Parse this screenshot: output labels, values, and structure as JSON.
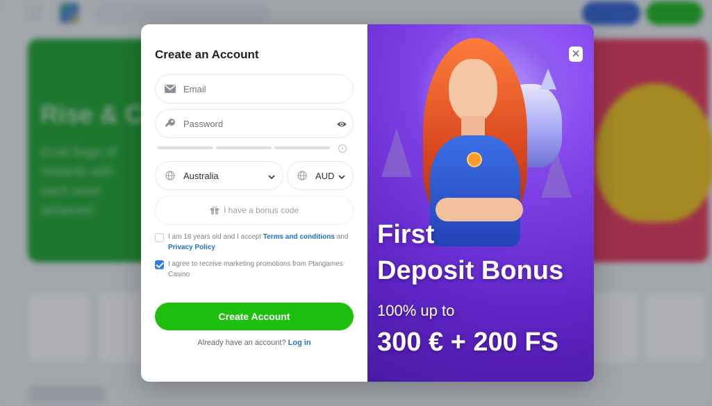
{
  "modal": {
    "title": "Create an Account",
    "email_placeholder": "Email",
    "password_placeholder": "Password",
    "country_value": "Australia",
    "currency_value": "AUD",
    "bonus_code_label": "I have a bonus code",
    "terms": {
      "prefix": "I am 18 years old and I accept",
      "link": "Terms and conditions",
      "mid": "and",
      "link2": "Privacy Policy",
      "checked": false
    },
    "marketing": {
      "text": "I agree to receive marketing promotions from Plangames Casino",
      "checked": true
    },
    "create_button": "Create Account",
    "login_prompt": "Already have an account?",
    "login_link": "Log in"
  },
  "promo": {
    "line1": "First",
    "line2": "Deposit Bonus",
    "line3": "100% up to",
    "line4": "300 € + 200 FS"
  },
  "background": {
    "banner_title": "Rise & Co",
    "banner_text": "Grab bags of rewards with each level achieved"
  },
  "colors": {
    "accent_green": "#1fbf0f",
    "link_blue": "#1f6fd1",
    "promo_purple": "#6a2fd0"
  }
}
